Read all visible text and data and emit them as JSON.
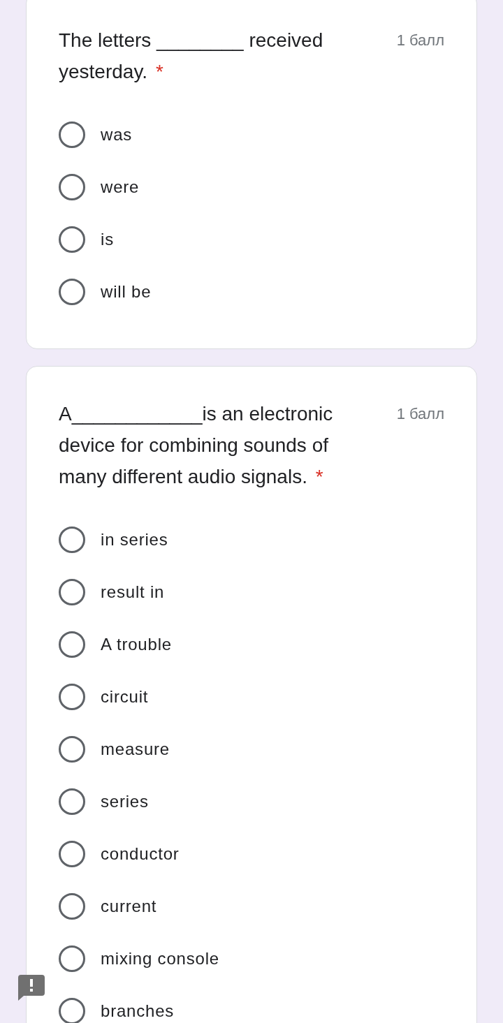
{
  "questions": [
    {
      "text": "The letters ________ received yesterday.",
      "required_mark": "*",
      "points": "1 балл",
      "options": [
        {
          "label": "was",
          "selected": false
        },
        {
          "label": "were",
          "selected": false
        },
        {
          "label": "is",
          "selected": false
        },
        {
          "label": "will be",
          "selected": false
        }
      ]
    },
    {
      "text": "A____________is an electronic device for combining sounds of many different audio signals.",
      "required_mark": "*",
      "points": "1 балл",
      "options": [
        {
          "label": "in series",
          "selected": false
        },
        {
          "label": "result in",
          "selected": false
        },
        {
          "label": "A trouble",
          "selected": false
        },
        {
          "label": "circuit",
          "selected": false
        },
        {
          "label": "measure",
          "selected": false
        },
        {
          "label": "series",
          "selected": false
        },
        {
          "label": "conductor",
          "selected": false
        },
        {
          "label": "current",
          "selected": false
        },
        {
          "label": "mixing console",
          "selected": false
        },
        {
          "label": "branches",
          "selected": false
        }
      ]
    }
  ]
}
